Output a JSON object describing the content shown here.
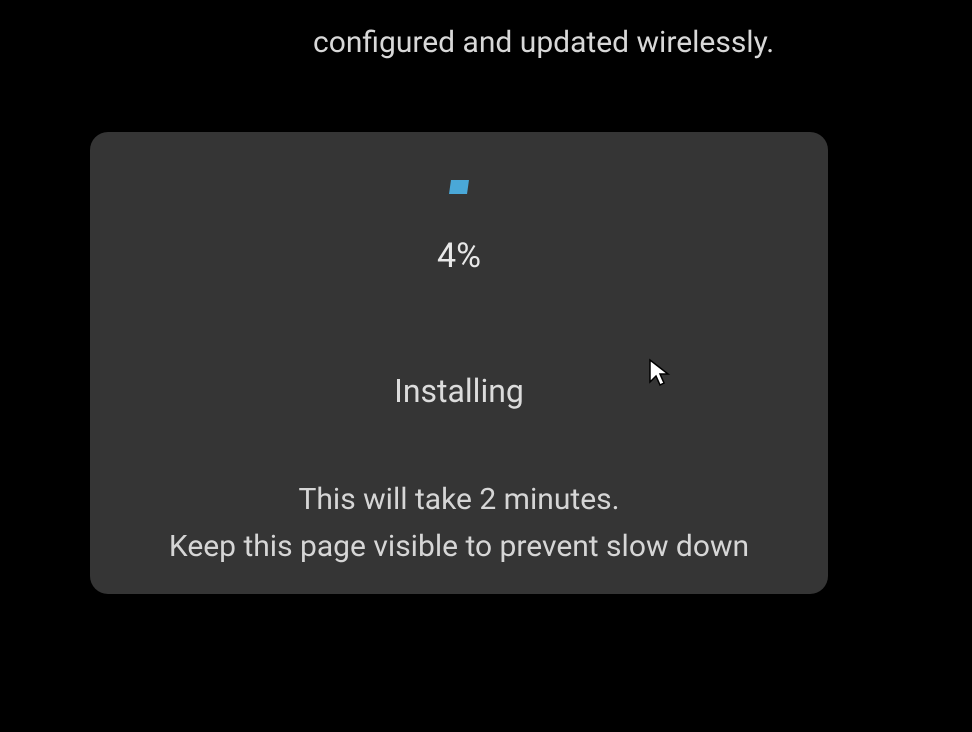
{
  "background": {
    "partial_text": "configured and updated wirelessly."
  },
  "modal": {
    "progress_percent": "4%",
    "status": "Installing",
    "info_line_1": "This will take 2 minutes.",
    "info_line_2": "Keep this page visible to prevent slow down"
  }
}
